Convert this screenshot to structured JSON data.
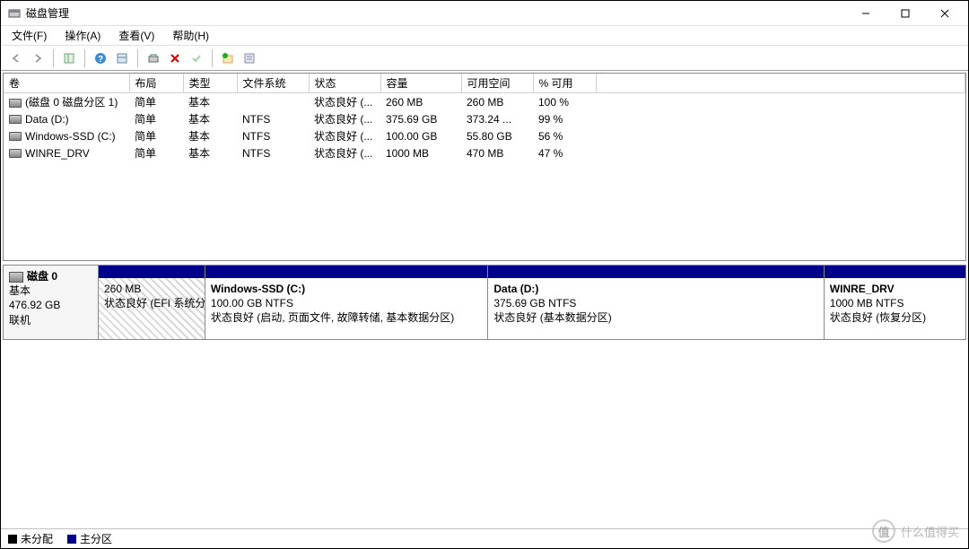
{
  "window": {
    "title": "磁盘管理"
  },
  "menu": {
    "file": "文件(F)",
    "action": "操作(A)",
    "view": "查看(V)",
    "help": "帮助(H)"
  },
  "columns": {
    "volume": "卷",
    "layout": "布局",
    "type": "类型",
    "fs": "文件系统",
    "status": "状态",
    "capacity": "容量",
    "free": "可用空间",
    "pct": "% 可用"
  },
  "volumes": [
    {
      "name": "(磁盘 0 磁盘分区 1)",
      "layout": "简单",
      "type": "基本",
      "fs": "",
      "status": "状态良好 (...",
      "capacity": "260 MB",
      "free": "260 MB",
      "pct": "100 %"
    },
    {
      "name": "Data (D:)",
      "layout": "简单",
      "type": "基本",
      "fs": "NTFS",
      "status": "状态良好 (...",
      "capacity": "375.69 GB",
      "free": "373.24 ...",
      "pct": "99 %"
    },
    {
      "name": "Windows-SSD (C:)",
      "layout": "简单",
      "type": "基本",
      "fs": "NTFS",
      "status": "状态良好 (...",
      "capacity": "100.00 GB",
      "free": "55.80 GB",
      "pct": "56 %"
    },
    {
      "name": "WINRE_DRV",
      "layout": "简单",
      "type": "基本",
      "fs": "NTFS",
      "status": "状态良好 (...",
      "capacity": "1000 MB",
      "free": "470 MB",
      "pct": "47 %"
    }
  ],
  "disk": {
    "label": "磁盘 0",
    "type": "基本",
    "size": "476.92 GB",
    "state": "联机"
  },
  "partitions": [
    {
      "title": "",
      "line2": "260 MB",
      "line3": "状态良好 (EFI 系统分区)",
      "hatched": true,
      "flex": 12
    },
    {
      "title": "Windows-SSD  (C:)",
      "line2": "100.00 GB NTFS",
      "line3": "状态良好 (启动, 页面文件, 故障转储, 基本数据分区)",
      "hatched": false,
      "flex": 32
    },
    {
      "title": "Data  (D:)",
      "line2": "375.69 GB NTFS",
      "line3": "状态良好 (基本数据分区)",
      "hatched": false,
      "flex": 38
    },
    {
      "title": "WINRE_DRV",
      "line2": "1000 MB NTFS",
      "line3": "状态良好 (恢复分区)",
      "hatched": false,
      "flex": 16
    }
  ],
  "legend": {
    "unallocated": "未分配",
    "primary": "主分区"
  },
  "watermark": {
    "badge": "值",
    "text": "什么值得买"
  }
}
